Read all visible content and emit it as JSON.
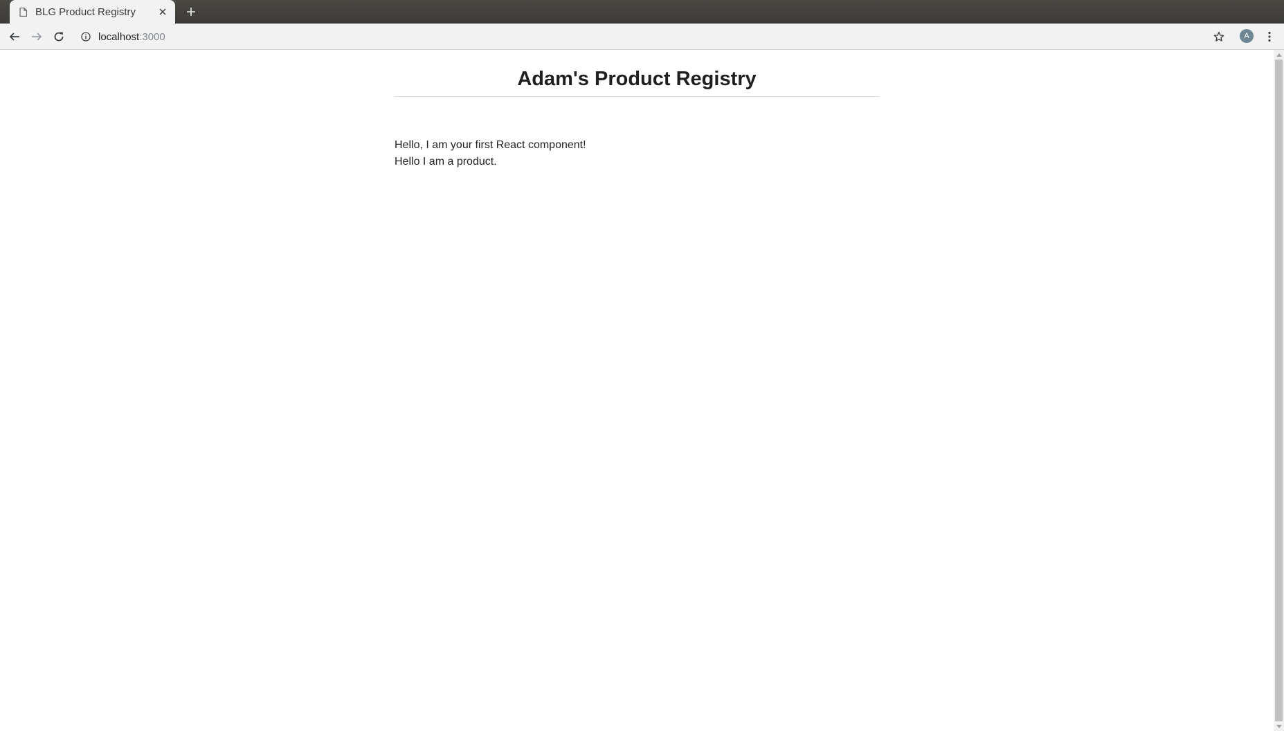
{
  "browser": {
    "tab": {
      "title": "BLG Product Registry"
    },
    "address": {
      "host": "localhost",
      "port": ":3000"
    },
    "profile_initial": "A",
    "icons": {
      "page": "page-icon",
      "close": "close-icon",
      "new_tab": "plus-icon",
      "back": "back-arrow-icon",
      "forward": "forward-arrow-icon",
      "reload": "reload-icon",
      "info": "info-icon",
      "bookmark": "star-icon",
      "menu": "kebab-menu-icon"
    }
  },
  "page": {
    "title": "Adam's Product Registry",
    "lines": [
      "Hello, I am your first React component!",
      "Hello I am a product."
    ]
  }
}
